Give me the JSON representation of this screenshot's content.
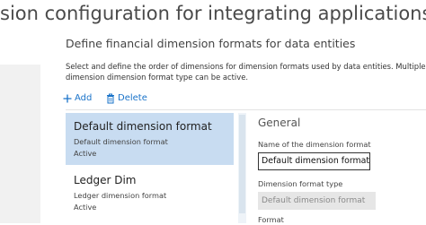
{
  "page": {
    "title": "sion configuration for integrating applications"
  },
  "section": {
    "title": "Define financial dimension formats for data entities",
    "description": "Select and define the order of dimensions for dimension formats used by data entities. Multiple dimension dimension format type can be active."
  },
  "toolbar": {
    "add_label": "Add",
    "add_icon": "plus-icon",
    "delete_label": "Delete",
    "delete_icon": "trash-icon",
    "accent_color": "#1a73c9"
  },
  "list": {
    "selected_background": "#c8dcf1",
    "items": [
      {
        "title": "Default dimension format",
        "subtitle": "Default dimension format",
        "status": "Active"
      },
      {
        "title": "Ledger Dim",
        "subtitle": "Ledger dimension format",
        "status": "Active"
      }
    ]
  },
  "detail": {
    "header": "General",
    "name_label": "Name of the dimension format",
    "name_value": "Default dimension format",
    "type_label": "Dimension format type",
    "type_value": "Default dimension format",
    "next_label": "Format"
  }
}
